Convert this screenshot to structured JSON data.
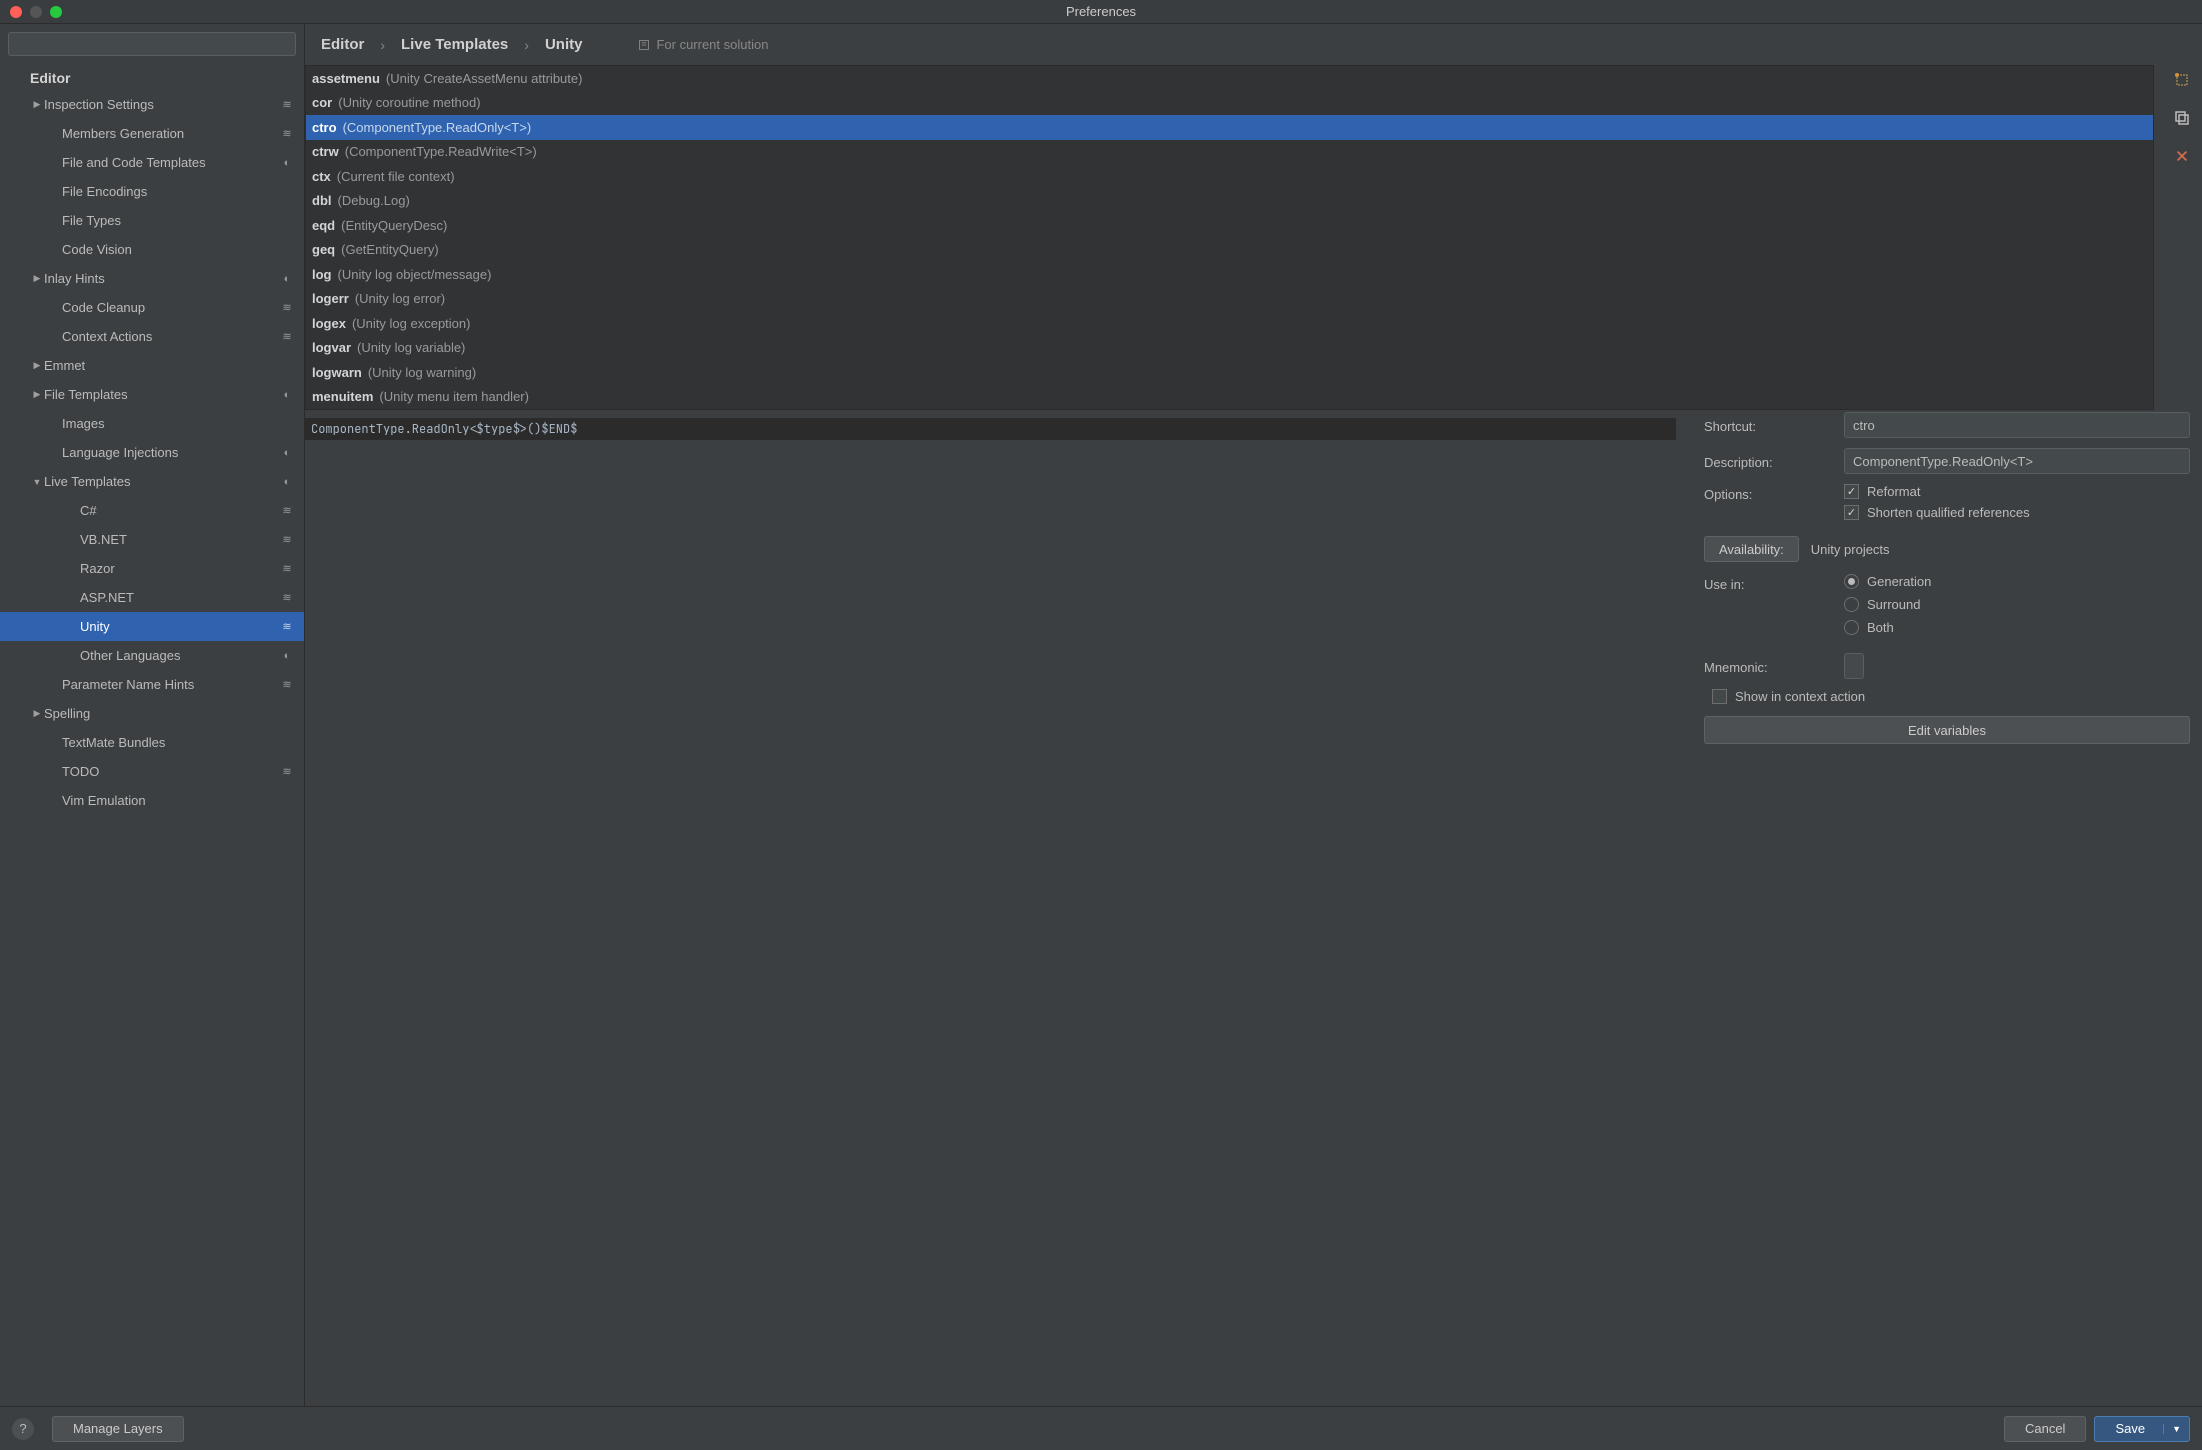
{
  "window": {
    "title": "Preferences"
  },
  "search": {
    "placeholder": ""
  },
  "tree": {
    "heading": "Editor",
    "items": [
      {
        "label": "Inspection Settings",
        "indent": 1,
        "arrow": "right",
        "icon": "layers"
      },
      {
        "label": "Members Generation",
        "indent": 2,
        "arrow": "",
        "icon": "layers"
      },
      {
        "label": "File and Code Templates",
        "indent": 2,
        "arrow": "",
        "icon": "half"
      },
      {
        "label": "File Encodings",
        "indent": 2,
        "arrow": "",
        "icon": ""
      },
      {
        "label": "File Types",
        "indent": 2,
        "arrow": "",
        "icon": ""
      },
      {
        "label": "Code Vision",
        "indent": 2,
        "arrow": "",
        "icon": ""
      },
      {
        "label": "Inlay Hints",
        "indent": 1,
        "arrow": "right",
        "icon": "half"
      },
      {
        "label": "Code Cleanup",
        "indent": 2,
        "arrow": "",
        "icon": "layers"
      },
      {
        "label": "Context Actions",
        "indent": 2,
        "arrow": "",
        "icon": "layers"
      },
      {
        "label": "Emmet",
        "indent": 1,
        "arrow": "right",
        "icon": ""
      },
      {
        "label": "File Templates",
        "indent": 1,
        "arrow": "right",
        "icon": "half"
      },
      {
        "label": "Images",
        "indent": 2,
        "arrow": "",
        "icon": ""
      },
      {
        "label": "Language Injections",
        "indent": 2,
        "arrow": "",
        "icon": "half"
      },
      {
        "label": "Live Templates",
        "indent": 1,
        "arrow": "down",
        "icon": "half",
        "selected": false
      },
      {
        "label": "C#",
        "indent": 3,
        "arrow": "",
        "icon": "layers"
      },
      {
        "label": "VB.NET",
        "indent": 3,
        "arrow": "",
        "icon": "layers"
      },
      {
        "label": "Razor",
        "indent": 3,
        "arrow": "",
        "icon": "layers"
      },
      {
        "label": "ASP.NET",
        "indent": 3,
        "arrow": "",
        "icon": "layers"
      },
      {
        "label": "Unity",
        "indent": 3,
        "arrow": "",
        "icon": "layers",
        "selected": true
      },
      {
        "label": "Other Languages",
        "indent": 3,
        "arrow": "",
        "icon": "half"
      },
      {
        "label": "Parameter Name Hints",
        "indent": 2,
        "arrow": "",
        "icon": "layers"
      },
      {
        "label": "Spelling",
        "indent": 1,
        "arrow": "right",
        "icon": ""
      },
      {
        "label": "TextMate Bundles",
        "indent": 2,
        "arrow": "",
        "icon": ""
      },
      {
        "label": "TODO",
        "indent": 2,
        "arrow": "",
        "icon": "layers"
      },
      {
        "label": "Vim Emulation",
        "indent": 2,
        "arrow": "",
        "icon": ""
      }
    ]
  },
  "breadcrumb": {
    "crumbs": [
      "Editor",
      "Live Templates",
      "Unity"
    ],
    "scope": "For current solution"
  },
  "templates": [
    {
      "abbr": "assetmenu",
      "desc": "(Unity CreateAssetMenu attribute)"
    },
    {
      "abbr": "cor",
      "desc": "(Unity coroutine method)"
    },
    {
      "abbr": "ctro",
      "desc": "(ComponentType.ReadOnly<T>)",
      "selected": true
    },
    {
      "abbr": "ctrw",
      "desc": "(ComponentType.ReadWrite<T>)"
    },
    {
      "abbr": "ctx",
      "desc": "(Current file context)"
    },
    {
      "abbr": "dbl",
      "desc": "(Debug.Log)"
    },
    {
      "abbr": "eqd",
      "desc": "(EntityQueryDesc)"
    },
    {
      "abbr": "geq",
      "desc": "(GetEntityQuery)"
    },
    {
      "abbr": "log",
      "desc": "(Unity log object/message)"
    },
    {
      "abbr": "logerr",
      "desc": "(Unity log error)"
    },
    {
      "abbr": "logex",
      "desc": "(Unity log exception)"
    },
    {
      "abbr": "logvar",
      "desc": "(Unity log variable)"
    },
    {
      "abbr": "logwarn",
      "desc": "(Unity log warning)"
    },
    {
      "abbr": "menuitem",
      "desc": "(Unity menu item handler)"
    }
  ],
  "code": "ComponentType.ReadOnly<$type$>()$END$",
  "form": {
    "shortcut_label": "Shortcut:",
    "shortcut_value": "ctro",
    "description_label": "Description:",
    "description_value": "ComponentType.ReadOnly<T>",
    "options_label": "Options:",
    "opt_reformat": "Reformat",
    "opt_shorten": "Shorten qualified references",
    "availability_btn": "Availability:",
    "availability_text": "Unity projects",
    "usein_label": "Use in:",
    "usein_generation": "Generation",
    "usein_surround": "Surround",
    "usein_both": "Both",
    "mnemonic_label": "Mnemonic:",
    "show_ctx": "Show in context action",
    "edit_vars": "Edit variables"
  },
  "footer": {
    "manage_layers": "Manage Layers",
    "cancel": "Cancel",
    "save": "Save"
  }
}
